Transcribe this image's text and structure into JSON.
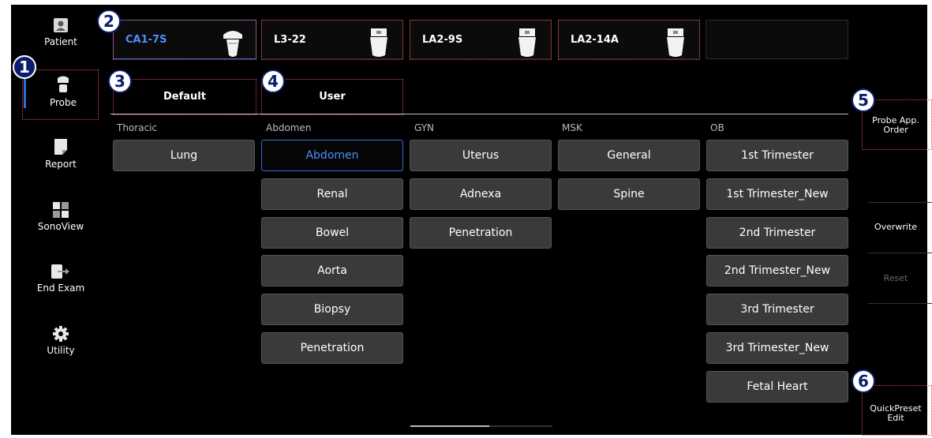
{
  "sidebar": {
    "items": [
      {
        "label": "Patient",
        "icon": "patient-icon"
      },
      {
        "label": "Probe",
        "icon": "probe-icon"
      },
      {
        "label": "Report",
        "icon": "report-icon"
      },
      {
        "label": "SonoView",
        "icon": "sonoview-icon"
      },
      {
        "label": "End Exam",
        "icon": "end-exam-icon"
      },
      {
        "label": "Utility",
        "icon": "gear-icon"
      }
    ]
  },
  "probes": [
    {
      "name": "CA1-7S",
      "active": true
    },
    {
      "name": "L3-22",
      "active": false
    },
    {
      "name": "LA2-9S",
      "active": false
    },
    {
      "name": "LA2-14A",
      "active": false
    },
    {
      "name": "",
      "active": false
    }
  ],
  "tabs": [
    {
      "label": "Default"
    },
    {
      "label": "User"
    }
  ],
  "categories": [
    {
      "title": "Thoracic",
      "presets": [
        "Lung"
      ]
    },
    {
      "title": "Abdomen",
      "presets": [
        "Abdomen",
        "Renal",
        "Bowel",
        "Aorta",
        "Biopsy",
        "Penetration"
      ],
      "selected": "Abdomen"
    },
    {
      "title": "GYN",
      "presets": [
        "Uterus",
        "Adnexa",
        "Penetration"
      ]
    },
    {
      "title": "MSK",
      "presets": [
        "General",
        "Spine"
      ]
    },
    {
      "title": "OB",
      "presets": [
        "1st Trimester",
        "1st Trimester_New",
        "2nd Trimester",
        "2nd Trimester_New",
        "3rd Trimester",
        "3rd Trimester_New",
        "Fetal Heart"
      ]
    }
  ],
  "side_buttons": {
    "probe_app_order_l1": "Probe App.",
    "probe_app_order_l2": "Order",
    "overwrite": "Overwrite",
    "reset": "Reset",
    "quickpreset_l1": "QuickPreset",
    "quickpreset_l2": "Edit"
  },
  "callouts": [
    "1",
    "2",
    "3",
    "4",
    "5",
    "6"
  ],
  "colors": {
    "accent": "#4a90ff",
    "callout_border": "#e0424a",
    "callout_badge": "#0c1d6e"
  }
}
